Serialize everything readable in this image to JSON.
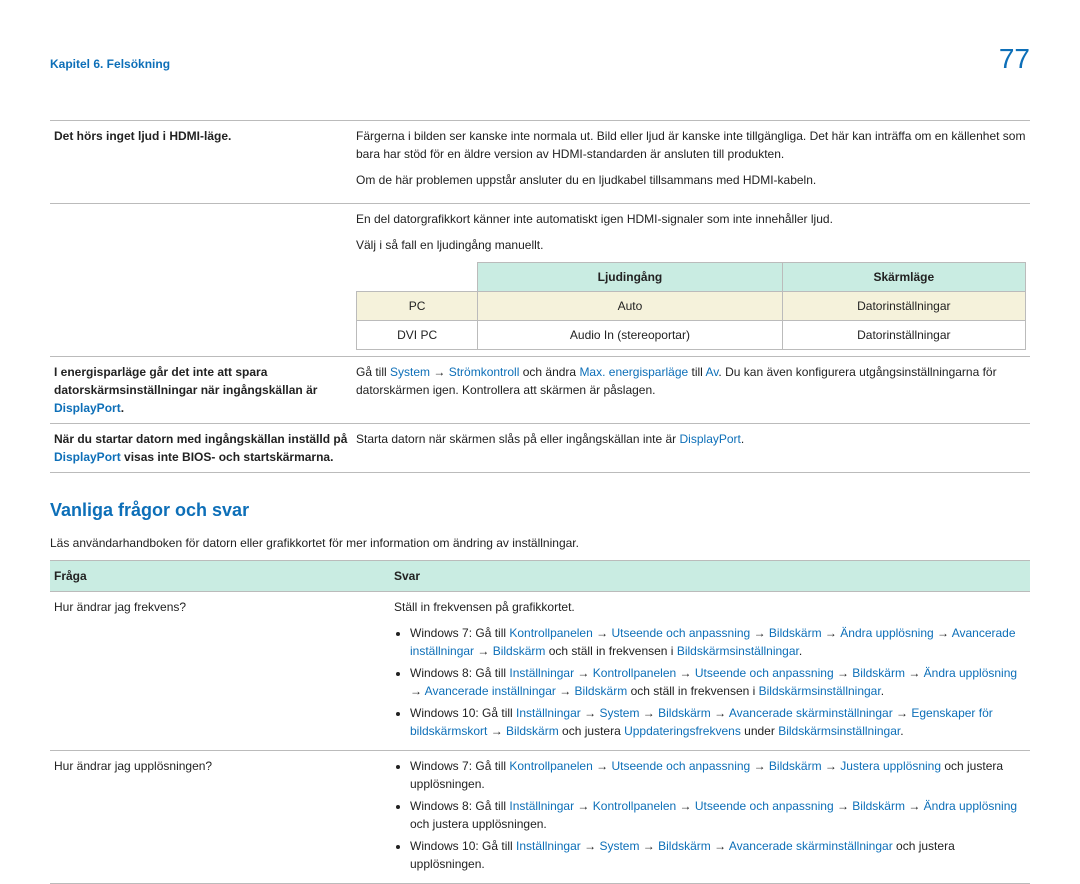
{
  "header": {
    "breadcrumb": "Kapitel 6. Felsökning",
    "page_number": "77"
  },
  "troubleshoot": {
    "row1": {
      "issue": "Det hörs inget ljud i HDMI-läge.",
      "p1": "Färgerna i bilden ser kanske inte normala ut. Bild eller ljud är kanske inte tillgängliga. Det här kan inträffa om en källenhet som bara har stöd för en äldre version av HDMI-standarden är ansluten till produkten.",
      "p2": "Om de här problemen uppstår ansluter du en ljudkabel tillsammans med HDMI-kabeln.",
      "p3": "En del datorgrafikkort känner inte automatiskt igen HDMI-signaler som inte innehåller ljud.",
      "p4": "Välj i så fall en ljudingång manuellt.",
      "subtable": {
        "h1": "",
        "h2": "Ljudingång",
        "h3": "Skärmläge",
        "r1c1": "PC",
        "r1c2": "Auto",
        "r1c3": "Datorinställningar",
        "r2c1": "DVI PC",
        "r2c2": "Audio In (stereoportar)",
        "r2c3": "Datorinställningar"
      }
    },
    "row2": {
      "issue_pre": "I energisparläge går det inte att spara datorskärmsinställningar när ingångskällan är ",
      "issue_link": "DisplayPort",
      "issue_post": ".",
      "ans_pre": "Gå till ",
      "ans_l1": "System",
      "ans_ar1": " → ",
      "ans_l2": "Strömkontroll",
      "ans_mid1": " och ändra ",
      "ans_l3": "Max. energisparläge",
      "ans_mid2": " till ",
      "ans_l4": "Av",
      "ans_post": ". Du kan även konfigurera utgångsinställningarna för datorskärmen igen. Kontrollera att skärmen är påslagen."
    },
    "row3": {
      "issue_pre": "När du startar datorn med ingångskällan inställd på ",
      "issue_link": "DisplayPort",
      "issue_post": " visas inte BIOS- och startskärmarna.",
      "ans_pre": "Starta datorn när skärmen slås på eller ingångskällan inte är ",
      "ans_link": "DisplayPort",
      "ans_post": "."
    }
  },
  "faq": {
    "title": "Vanliga frågor och svar",
    "intro": "Läs användarhandboken för datorn eller grafikkortet för mer information om ändring av inställningar.",
    "header_q": "Fråga",
    "header_a": "Svar",
    "q1": {
      "q": "Hur ändrar jag frekvens?",
      "lead": "Ställ in frekvensen på grafikkortet.",
      "w7": {
        "pre": "Windows 7: Gå till ",
        "l1": "Kontrollpanelen",
        "l2": "Utseende och anpassning",
        "l3": "Bildskärm",
        "l4": "Ändra upplösning",
        "l5": "Avancerade inställningar",
        "l6": "Bildskärm",
        "mid": " och ställ in frekvensen i ",
        "l7": "Bildskärmsinställningar",
        "post": "."
      },
      "w8": {
        "pre": "Windows 8: Gå till ",
        "l1": "Inställningar",
        "l2": "Kontrollpanelen",
        "l3": "Utseende och anpassning",
        "l4": "Bildskärm",
        "l5": "Ändra upplösning",
        "l6": "Avancerade inställningar",
        "l7": "Bildskärm",
        "mid": " och ställ in frekvensen i ",
        "l8": "Bildskärmsinställningar",
        "post": "."
      },
      "w10": {
        "pre": "Windows 10: Gå till ",
        "l1": "Inställningar",
        "l2": "System",
        "l3": "Bildskärm",
        "l4": "Avancerade skärminställningar",
        "l5": "Egenskaper för bildskärmskort",
        "l6": "Bildskärm",
        "mid": " och justera ",
        "l7": "Uppdateringsfrekvens",
        "mid2": " under ",
        "l8": "Bildskärmsinställningar",
        "post": "."
      }
    },
    "q2": {
      "q": "Hur ändrar jag upplösningen?",
      "w7": {
        "pre": "Windows 7: Gå till ",
        "l1": "Kontrollpanelen",
        "l2": "Utseende och anpassning",
        "l3": "Bildskärm",
        "l4": "Justera upplösning",
        "post": " och justera upplösningen."
      },
      "w8": {
        "pre": "Windows 8: Gå till ",
        "l1": "Inställningar",
        "l2": "Kontrollpanelen",
        "l3": "Utseende och anpassning",
        "l4": "Bildskärm",
        "l5": "Ändra upplösning",
        "post": " och justera upplösningen."
      },
      "w10": {
        "pre": "Windows 10: Gå till ",
        "l1": "Inställningar",
        "l2": "System",
        "l3": "Bildskärm",
        "l4": "Avancerade skärminställningar",
        "post": " och justera upplösningen."
      }
    }
  }
}
